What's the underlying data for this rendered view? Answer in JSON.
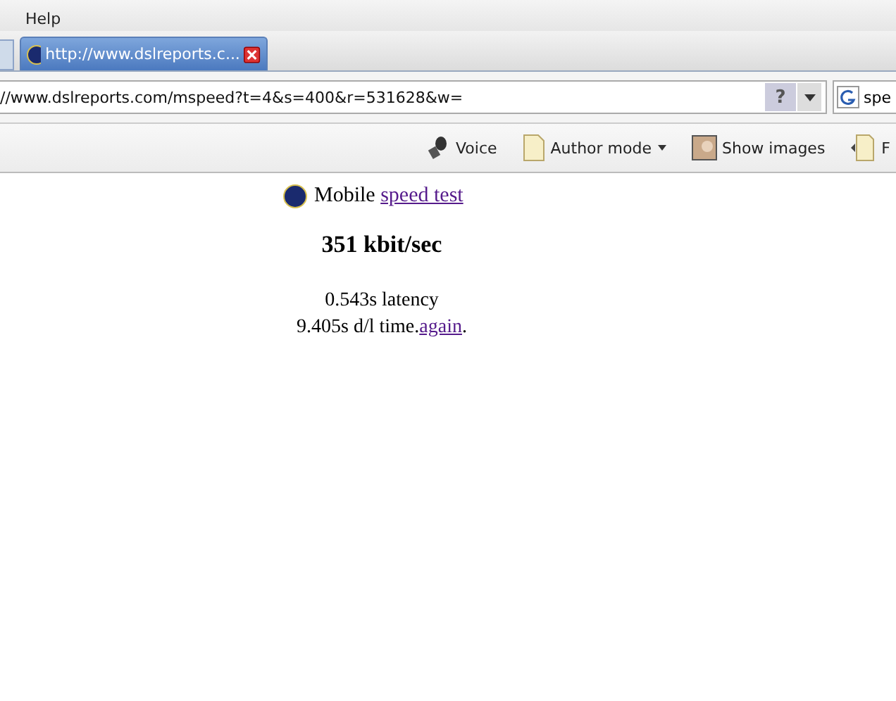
{
  "menu_bar": {
    "items": [
      "Help"
    ]
  },
  "tabs": [
    {
      "title": "http://www.dslreports.c...",
      "selected": true
    }
  ],
  "address_bar": {
    "url": "//www.dslreports.com/mspeed?t=4&s=400&r=531628&w=",
    "help_button": "?",
    "search_value": "spe"
  },
  "toolbar": {
    "items": [
      {
        "kind": "voice",
        "label": "Voice"
      },
      {
        "kind": "author",
        "label": "Author mode"
      },
      {
        "kind": "images",
        "label": "Show images"
      },
      {
        "kind": "cut",
        "label": "F"
      }
    ]
  },
  "page": {
    "title_text": "Mobile",
    "title_link": "speed test",
    "speed": "351 kbit/sec",
    "latency": "0.543s latency",
    "time": "9.405s d/l time.",
    "again_link": "again",
    "again_suffix": "."
  }
}
